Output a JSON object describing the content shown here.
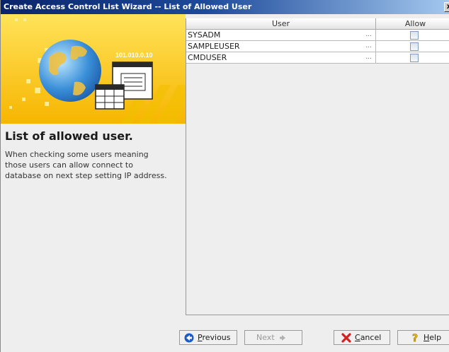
{
  "window": {
    "title": "Create Access Control List Wizard -- List of Allowed User",
    "close_glyph": "x"
  },
  "banner": {
    "ip_text": "101.010.0.10"
  },
  "left": {
    "heading": "List of allowed user.",
    "description": "When checking some users meaning those users can allow connect to database on next step setting IP address."
  },
  "table": {
    "columns": [
      "User",
      "Allow"
    ],
    "rows": [
      {
        "user": "SYSADM",
        "allow": false
      },
      {
        "user": "SAMPLEUSER",
        "allow": false
      },
      {
        "user": "CMDUSER",
        "allow": false
      }
    ],
    "ellipsis": "..."
  },
  "buttons": {
    "previous": {
      "label_u": "P",
      "label_rest": "revious"
    },
    "next": {
      "label": "Next"
    },
    "cancel": {
      "label_u": "C",
      "label_rest": "ancel"
    },
    "help": {
      "label_u": "H",
      "label_rest": "elp"
    }
  },
  "colors": {
    "title_start": "#0a246a",
    "title_end": "#a6caf0",
    "banner": "#fdd21c",
    "arrow_blue": "#1e5bc6",
    "cancel_red": "#d42020"
  },
  "icons": [
    "globe-icon",
    "database-table-icon",
    "window-icon",
    "arrow-left-icon",
    "arrow-right-icon",
    "cancel-x-icon",
    "help-question-icon"
  ]
}
